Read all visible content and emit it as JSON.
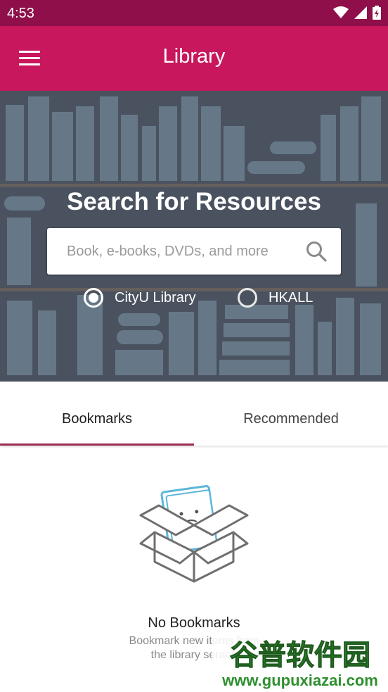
{
  "status_bar": {
    "time": "4:53",
    "icons": [
      "wifi-icon",
      "cell-signal-icon",
      "battery-charging-icon"
    ]
  },
  "app_bar": {
    "title": "Library",
    "menu_icon": "hamburger-menu-icon"
  },
  "hero": {
    "title": "Search for Resources",
    "search": {
      "placeholder": "Book, e-books, DVDs, and more",
      "value": ""
    },
    "options": [
      {
        "label": "CityU Library",
        "selected": true
      },
      {
        "label": "HKALL",
        "selected": false
      }
    ]
  },
  "tabs": [
    {
      "label": "Bookmarks",
      "active": true
    },
    {
      "label": "Recommended",
      "active": false
    }
  ],
  "empty_state": {
    "title": "No Bookmarks",
    "subtitle_line1": "Bookmark new items from",
    "subtitle_line2": "the library serach"
  },
  "watermark": {
    "text": "谷普软件园",
    "url": "www.gupuxiazai.com"
  },
  "colors": {
    "status_bar": "#8e0f4a",
    "app_bar": "#c8175d",
    "hero_bg": "#4a5260",
    "tab_indicator": "#9b2d52"
  }
}
